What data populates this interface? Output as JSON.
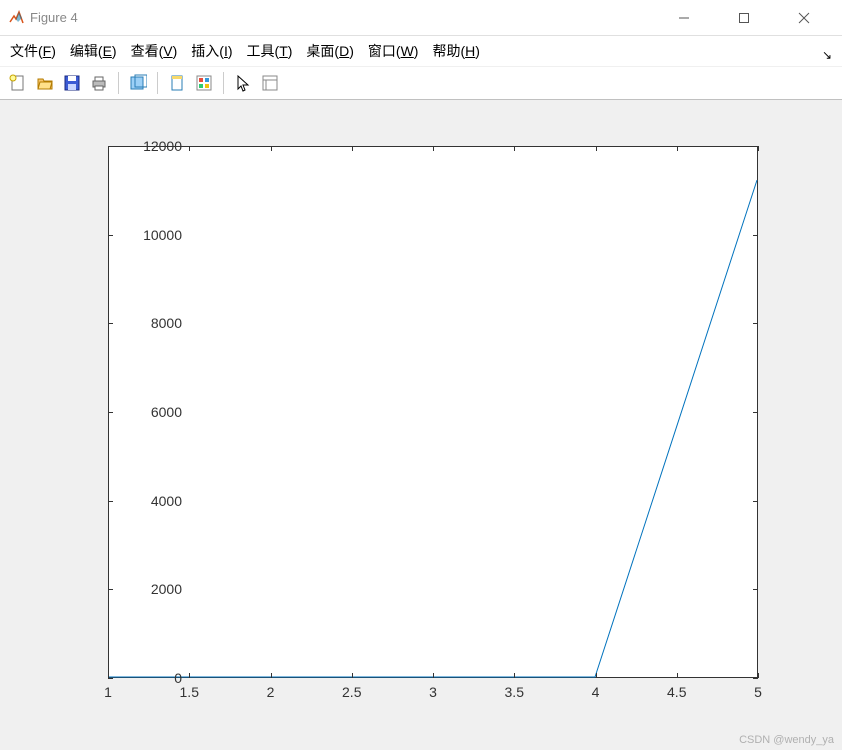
{
  "window": {
    "title": "Figure 4"
  },
  "menu": {
    "file": "文件",
    "file_hk": "F",
    "edit": "编辑",
    "edit_hk": "E",
    "view": "查看",
    "view_hk": "V",
    "insert": "插入",
    "insert_hk": "I",
    "tools": "工具",
    "tools_hk": "T",
    "desktop": "桌面",
    "desktop_hk": "D",
    "window": "窗口",
    "window_hk": "W",
    "help": "帮助",
    "help_hk": "H"
  },
  "toolbar": {
    "new": "new-figure-icon",
    "open": "open-icon",
    "save": "save-icon",
    "print": "print-icon",
    "inspector": "plot-edit-icon",
    "link": "link-data-icon",
    "colorbar": "insert-colorbar-icon",
    "cursor": "cursor-icon",
    "inspect": "property-inspector-icon"
  },
  "chart_data": {
    "type": "line",
    "x": [
      1,
      1.5,
      2,
      2.5,
      3,
      3.5,
      4,
      4.5,
      5
    ],
    "y": [
      0,
      0,
      0,
      0,
      0,
      0,
      0,
      5625,
      11250
    ],
    "xlim": [
      1,
      5
    ],
    "ylim": [
      0,
      12000
    ],
    "xticks": [
      1,
      1.5,
      2,
      2.5,
      3,
      3.5,
      4,
      4.5,
      5
    ],
    "yticks": [
      0,
      2000,
      4000,
      6000,
      8000,
      10000,
      12000
    ],
    "line_color": "#0072BD"
  },
  "watermark": "CSDN @wendy_ya"
}
